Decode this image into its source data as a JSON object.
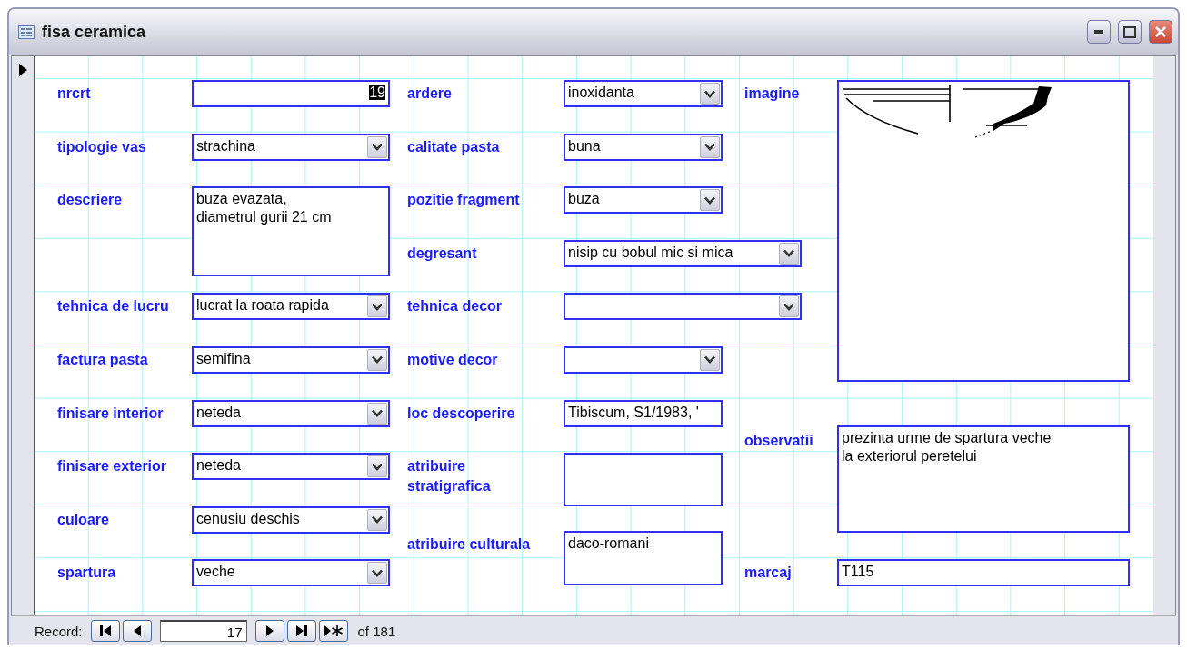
{
  "window": {
    "title": "fisa ceramica"
  },
  "columns": [
    [
      {
        "label": "nrcrt",
        "kind": "text",
        "value": "19",
        "highlighted": true
      },
      {
        "label": "tipologie vas",
        "kind": "combo",
        "value": "strachina"
      },
      {
        "label": "descriere",
        "kind": "memo",
        "value": "buza evazata,\ndiametrul gurii 21 cm"
      },
      {
        "label": "tehnica de lucru",
        "kind": "combo",
        "value": "lucrat la roata rapida"
      },
      {
        "label": "factura pasta",
        "kind": "combo",
        "value": "semifina"
      },
      {
        "label": "finisare interior",
        "kind": "combo",
        "value": "neteda"
      },
      {
        "label": "finisare exterior",
        "kind": "combo",
        "value": "neteda"
      },
      {
        "label": "culoare",
        "kind": "combo",
        "value": "cenusiu deschis"
      },
      {
        "label": "spartura",
        "kind": "combo",
        "value": "veche"
      }
    ],
    [
      {
        "label": "ardere",
        "kind": "combo",
        "value": "inoxidanta"
      },
      {
        "label": "calitate pasta",
        "kind": "combo",
        "value": "buna"
      },
      {
        "label": "pozitie fragment",
        "kind": "combo",
        "value": "buza"
      },
      {
        "label": "degresant",
        "kind": "combo",
        "value": "nisip cu bobul mic si mica"
      },
      {
        "label": "tehnica decor",
        "kind": "combo"
      },
      {
        "label": "motive decor",
        "kind": "combo"
      },
      {
        "label": "loc descoperire",
        "kind": "text",
        "value": "Tibiscum, S1/1983, '"
      },
      {
        "label": "atribuire stratigrafica",
        "kind": "memo"
      },
      {
        "label": "atribuire culturala",
        "kind": "memo",
        "value": "daco-romani"
      }
    ],
    [
      {
        "label": "imagine",
        "kind": "image"
      },
      {
        "label": "observatii",
        "kind": "memo",
        "value": "prezinta urme de spartura veche\nla exteriorul peretelui"
      },
      {
        "label": "marcaj",
        "kind": "text",
        "value": "T115"
      }
    ]
  ],
  "navigation": {
    "label": "Record:",
    "current": "17",
    "total_label": "of 181"
  }
}
